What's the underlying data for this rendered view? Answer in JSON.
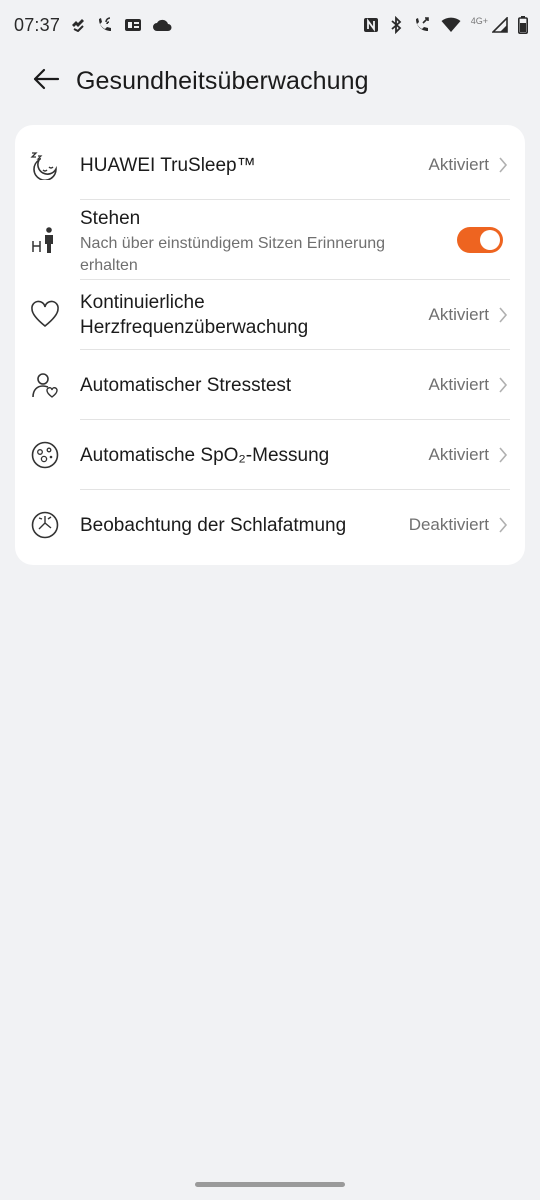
{
  "status_bar": {
    "time": "07:37",
    "network_label": "4G+",
    "left_icons": [
      "signal-hook-icon",
      "wifi-call-icon",
      "sim-card-icon",
      "cloud-icon"
    ],
    "right_icons": [
      "nfc-icon",
      "bluetooth-icon",
      "call-icon",
      "wifi-icon",
      "cellular-signal-icon",
      "battery-icon"
    ]
  },
  "header": {
    "title": "Gesundheitsüberwachung",
    "back_icon": "arrow-left-icon"
  },
  "settings": [
    {
      "label": "HUAWEI TruSleep™",
      "value": "Aktiviert",
      "icon": "sleep-moon-icon"
    },
    {
      "label": "Stehen",
      "sub": "Nach über einstündigem Sitzen Erinnerung erhalten",
      "toggle_on": true,
      "icon": "standing-person-icon"
    },
    {
      "label": "Kontinuierliche Herzfrequenzüberwachung",
      "value": "Aktiviert",
      "icon": "heart-icon"
    },
    {
      "label": "Automatischer Stresstest",
      "value": "Aktiviert",
      "icon": "person-heart-icon"
    },
    {
      "label": "Automatische SpO₂-Messung",
      "value": "Aktiviert",
      "icon": "spo2-icon"
    },
    {
      "label": "Beobachtung der Schlafatmung",
      "value": "Deaktiviert",
      "icon": "sleep-breathing-icon"
    }
  ],
  "colors": {
    "accent": "#ee6420",
    "background": "#f1f2f4",
    "card": "#ffffff"
  }
}
